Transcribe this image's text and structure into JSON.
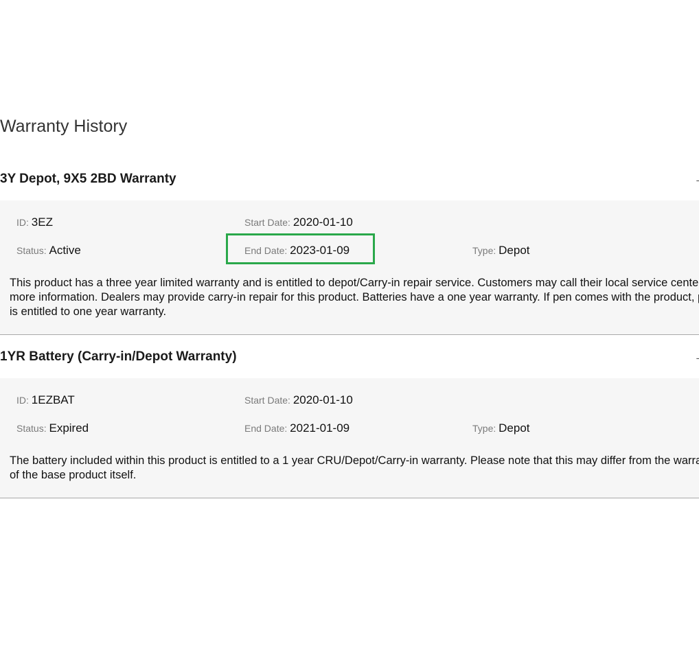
{
  "page": {
    "title": "Warranty History"
  },
  "warranties": [
    {
      "name": "3Y Depot, 9X5 2BD Warranty",
      "id_label": "ID",
      "id_value": "3EZ",
      "start_label": "Start Date",
      "start_value": "2020-01-10",
      "status_label": "Status",
      "status_value": "Active",
      "end_label": "End Date",
      "end_value": "2023-01-09",
      "type_label": "Type",
      "type_value": "Depot",
      "description": "This product has a three year limited warranty and is entitled to depot/Carry-in repair service. Customers may call their local service center for more information. Dealers may provide carry-in repair for this product. Batteries have a one year warranty. If pen comes with the product, pen is entitled to one year warranty."
    },
    {
      "name": "1YR Battery (Carry-in/Depot Warranty)",
      "id_label": "ID",
      "id_value": "1EZBAT",
      "start_label": "Start Date",
      "start_value": "2020-01-10",
      "status_label": "Status",
      "status_value": "Expired",
      "end_label": "End Date",
      "end_value": "2021-01-09",
      "type_label": "Type",
      "type_value": "Depot",
      "description": "The battery included within this product is entitled to a 1 year CRU/Depot/Carry-in warranty. Please note that this may differ from the warranty of the base product itself."
    }
  ],
  "colors": {
    "highlight": "#2aa84a",
    "panel_bg": "#f6f6f6",
    "label": "#7a7a7a"
  }
}
